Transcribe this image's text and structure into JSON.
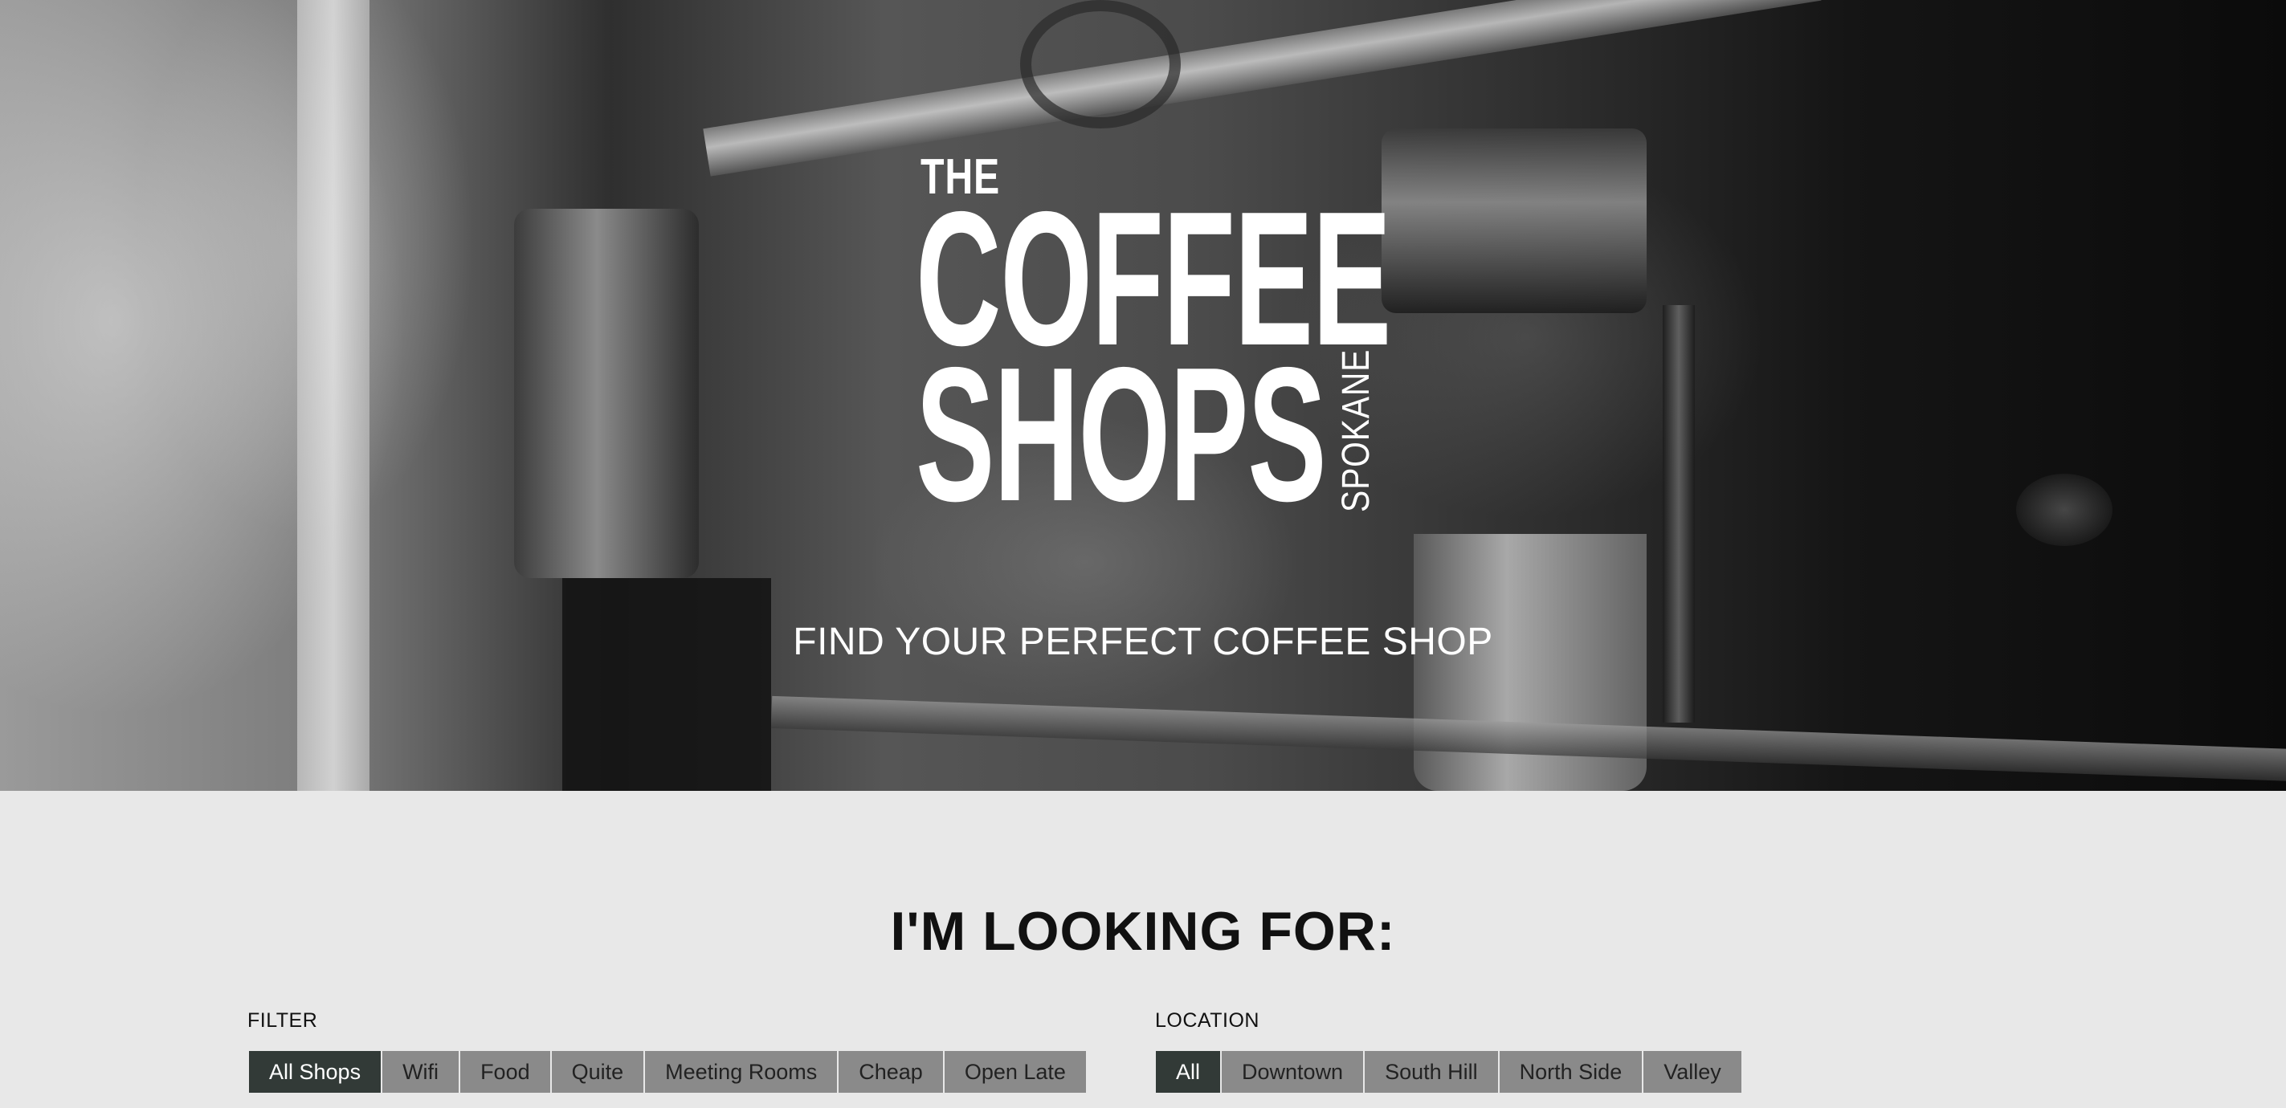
{
  "hero": {
    "logo": {
      "line1": "THE",
      "line2": "COFFEE",
      "line3": "SHOPS",
      "city": "SPOKANE"
    },
    "tagline": "FIND YOUR PERFECT COFFEE SHOP"
  },
  "search": {
    "heading": "I'M LOOKING FOR:",
    "filter": {
      "label": "FILTER",
      "options": [
        "All Shops",
        "Wifi",
        "Food",
        "Quite",
        "Meeting Rooms",
        "Cheap",
        "Open Late"
      ],
      "selected": "All Shops"
    },
    "location": {
      "label": "LOCATION",
      "options": [
        "All",
        "Downtown",
        "South Hill",
        "North Side",
        "Valley"
      ],
      "selected": "All"
    }
  },
  "colors": {
    "active_button": "#323a37",
    "inactive_button": "#8a8a8a",
    "page_background": "#e8e8e8"
  }
}
